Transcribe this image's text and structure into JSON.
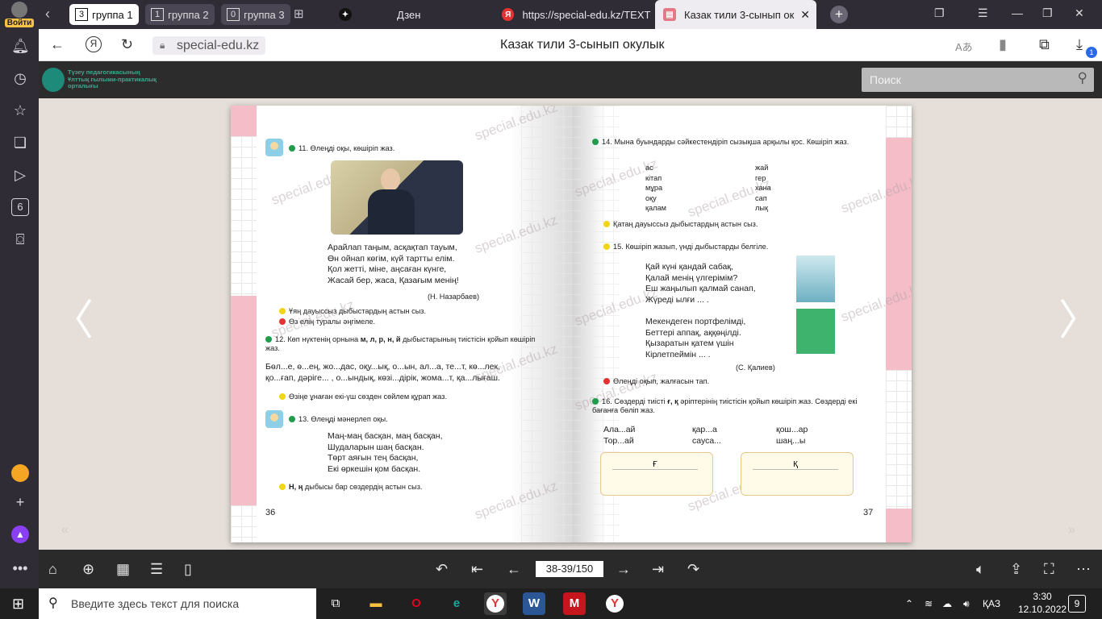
{
  "browser": {
    "login_label": "Войти",
    "groups": [
      {
        "count": "3",
        "label": "группа 1"
      },
      {
        "count": "1",
        "label": "группа 2"
      },
      {
        "count": "0",
        "label": "группа 3"
      }
    ],
    "tabs": [
      {
        "title": "Дзен"
      },
      {
        "title": "https://special-edu.kz/TEXT"
      },
      {
        "title": "Казак тили 3-сынып ок"
      }
    ],
    "url": "special-edu.kz",
    "page_title": "Казак тили 3-сынып окулык",
    "download_badge": "1",
    "sidebar_badge": "6"
  },
  "site": {
    "logo_text": "Түзеу педагогикасының Ұлттық ғылыми-практикалық орталығы",
    "search_placeholder": "Поиск"
  },
  "book": {
    "watermark": "special.edu.kz",
    "left": {
      "ex11": "11. Өлеңді оқы, көшіріп жаз.",
      "poem1": [
        "Арайлап таңым, асқақтап тауым,",
        "Өн ойнап көгім, күй тартты елім.",
        "Қол жетті, міне, аңсаған күнге,",
        "Жасай бер, жаса, Қазағым менің!"
      ],
      "author1": "(Н. Назарбаев)",
      "task_y1": "Ұяң дауыссыз дыбыстардың астын сыз.",
      "task_r1": "Өз елің туралы әңгімеле.",
      "ex12a": "12. Көп нүктенің орнына",
      "ex12b": "м, л, р, н, й",
      "ex12c": "дыбыстарының тиістісін қойып көшіріп жаз.",
      "words12": [
        "Бөл...е, ө...ең, жо...дас, оқу...ық, о...ын, ал...а, те...т, кө...лек,",
        "қо...ғап, дәріге... , о...ындық, көзі...дірік, жома...т, қа...лығаш."
      ],
      "task_y2": "Өзіңе ұнаған екі-үш сөзден сөйлем құрап жаз.",
      "ex13": "13. Өлеңді мәнерлеп оқы.",
      "poem2": [
        "Маң-маң басқан, маң басқан,",
        "Шудаларын шаң басқан.",
        "Төрт аяғын тең басқан,",
        "Екі өркешін қом басқан."
      ],
      "task_y3a": "Н, ң",
      "task_y3b": "дыбысы бар сөздердің астын сыз.",
      "page_no": "36"
    },
    "right": {
      "ex14": "14. Мына буындарды сәйкестендіріп сызықша арқылы қос. Көшіріп жаз.",
      "pairs": [
        [
          "ас",
          "жай"
        ],
        [
          "кітап",
          "гер"
        ],
        [
          "мұра",
          "хана"
        ],
        [
          "оқу",
          "сап"
        ],
        [
          "қалам",
          "лық"
        ]
      ],
      "task_y1": "Қатаң дауыссыз дыбыстардың астын сыз.",
      "task_y2": "15. Көшіріп жазып, үнді дыбыстарды белгіле.",
      "poem3": [
        "Қай күні қандай сабақ,",
        "Қалай менің үлгерімім?",
        "Еш жаңылып қалмай санап,",
        "Жүреді ылғи ... ."
      ],
      "poem4": [
        "Мекендеген портфелімді,",
        "Беттері аппақ, аққөңілді.",
        "Қызаратын қатем үшін",
        "Кірлетпеймін ... ."
      ],
      "author2": "(С. Қалиев)",
      "task_r1": "Өлеңді оқып, жалғасын тап.",
      "ex16a": "16. Сөздерді тиісті",
      "ex16b": "ғ, қ",
      "ex16c": "әріптерінің тиістісін қойып көшіріп жаз. Сөздерді екі бағанға бөліп жаз.",
      "words16": [
        [
          "Ала...ай",
          "қар...а",
          "қош...ар"
        ],
        [
          "Тор...ай",
          "сауса...",
          "шаң...ы"
        ]
      ],
      "box1": "Ғ",
      "box2": "Қ",
      "page_no": "37"
    }
  },
  "viewer": {
    "page_indicator": "38-39/150"
  },
  "taskbar": {
    "search_placeholder": "Введите здесь текст для поиска",
    "lang": "ҚАЗ",
    "time": "3:30",
    "date": "12.10.2022",
    "notif": "9"
  },
  "colors": {
    "accent_pink": "#f4bdc8",
    "green_dot": "#1f9d4b",
    "yellow_dot": "#f2d516",
    "red_dot": "#e53232"
  }
}
